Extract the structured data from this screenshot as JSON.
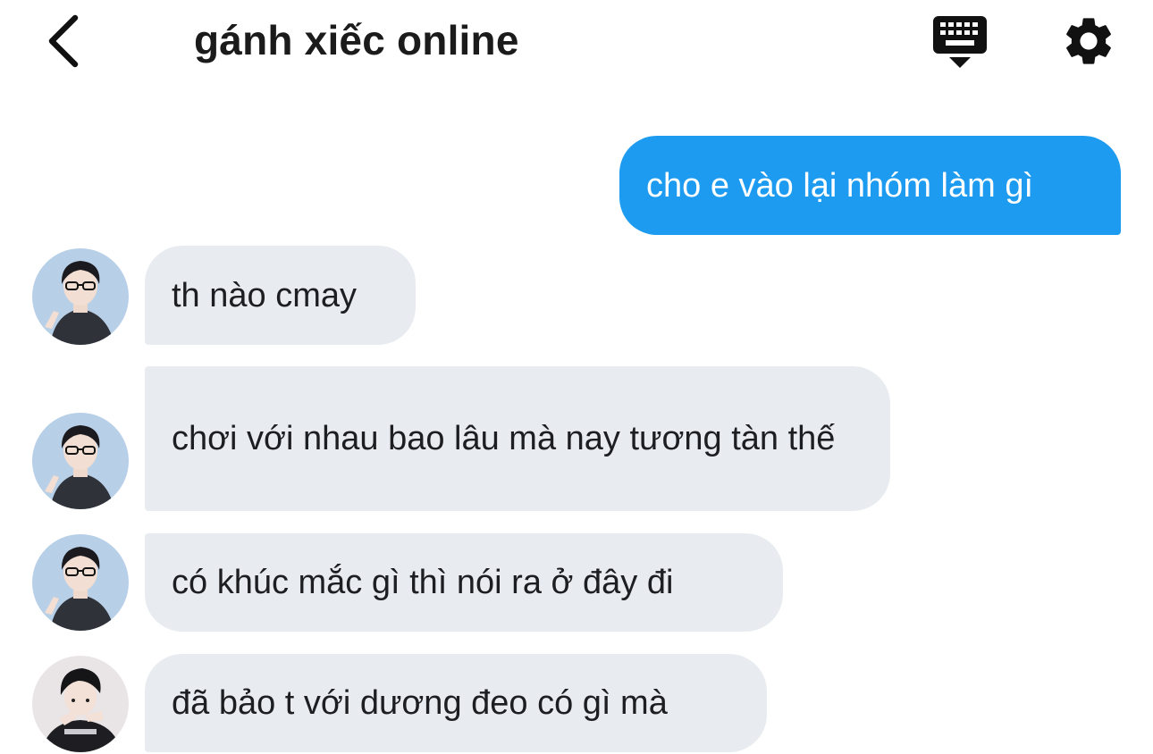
{
  "header": {
    "title": "gánh xiếc online",
    "back_icon": "chevron-left-icon",
    "keyboard_icon": "keyboard-icon",
    "settings_icon": "gear-icon"
  },
  "colors": {
    "sent_bubble": "#1d9bf0",
    "received_bubble": "#e8ecf1",
    "title_text": "#1b1b1b"
  },
  "messages": [
    {
      "direction": "sent",
      "text": "cho e vào lại nhóm làm gì"
    },
    {
      "direction": "received",
      "sender_avatar": "avatar-1",
      "text": "th nào cmay"
    },
    {
      "direction": "received",
      "sender_avatar": "avatar-1",
      "text": "chơi với nhau bao lâu mà nay tương tàn thế"
    },
    {
      "direction": "received",
      "sender_avatar": "avatar-1",
      "text": "có khúc mắc gì thì nói ra ở đây đi"
    },
    {
      "direction": "received",
      "sender_avatar": "avatar-2",
      "text": "đã bảo t với dương đeo có gì mà"
    }
  ]
}
